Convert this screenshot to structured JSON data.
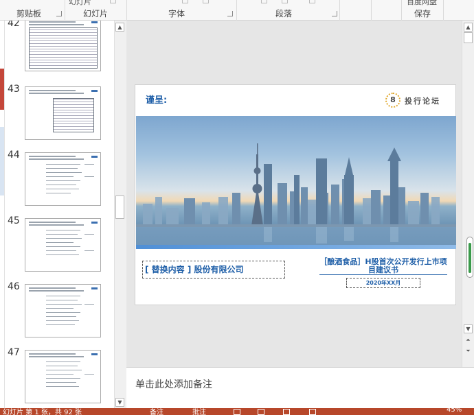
{
  "ribbon": {
    "groups": [
      "剪贴板",
      "幻灯片",
      "字体",
      "段落",
      "保存"
    ],
    "partial_top": {
      "slides_btn": "幻灯片",
      "save_btn": "百度网盘"
    }
  },
  "thumbnails": [
    {
      "number": "42",
      "style": "table"
    },
    {
      "number": "43",
      "style": "table-small"
    },
    {
      "number": "44",
      "style": "text"
    },
    {
      "number": "45",
      "style": "text"
    },
    {
      "number": "46",
      "style": "text"
    },
    {
      "number": "47",
      "style": "text"
    }
  ],
  "slide": {
    "greeting": "谨呈:",
    "logo_badge": "8",
    "logo_text": "投行论坛",
    "company": "[ 替换内容 ] 股份有限公司",
    "project_title": "［酿酒食品］H股首次公开发行上市项目建议书",
    "date": "2020年XX月"
  },
  "notes": {
    "placeholder": "单击此处添加备注"
  },
  "status": {
    "slide_info": "幻灯片 第 1 张，共 92 张",
    "notes_btn": "备注",
    "comments_btn": "批注",
    "zoom": "45%"
  },
  "colors": {
    "accent": "#1f5fa8",
    "status_bar": "#b7472a",
    "logo_gold": "#e0a72a"
  }
}
